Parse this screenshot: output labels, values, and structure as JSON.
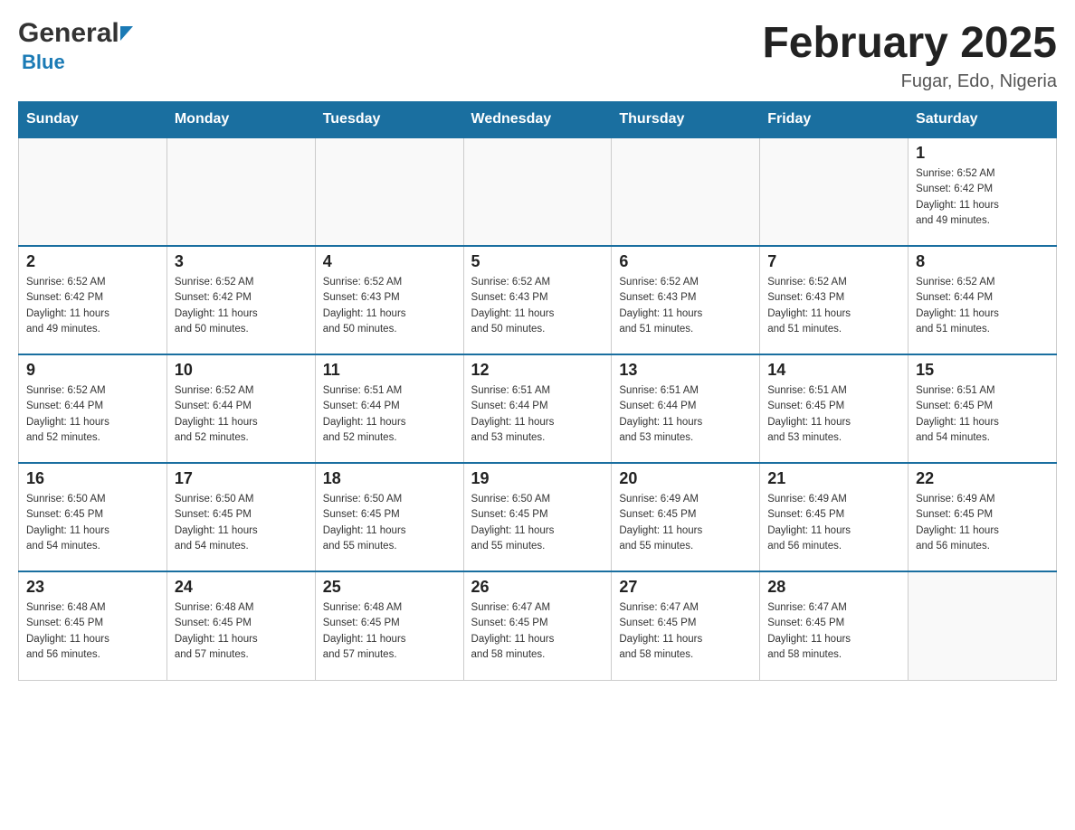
{
  "header": {
    "logo_general": "General",
    "logo_blue": "Blue",
    "month_title": "February 2025",
    "location": "Fugar, Edo, Nigeria"
  },
  "days_of_week": [
    "Sunday",
    "Monday",
    "Tuesday",
    "Wednesday",
    "Thursday",
    "Friday",
    "Saturday"
  ],
  "weeks": [
    [
      {
        "day": "",
        "info": ""
      },
      {
        "day": "",
        "info": ""
      },
      {
        "day": "",
        "info": ""
      },
      {
        "day": "",
        "info": ""
      },
      {
        "day": "",
        "info": ""
      },
      {
        "day": "",
        "info": ""
      },
      {
        "day": "1",
        "info": "Sunrise: 6:52 AM\nSunset: 6:42 PM\nDaylight: 11 hours\nand 49 minutes."
      }
    ],
    [
      {
        "day": "2",
        "info": "Sunrise: 6:52 AM\nSunset: 6:42 PM\nDaylight: 11 hours\nand 49 minutes."
      },
      {
        "day": "3",
        "info": "Sunrise: 6:52 AM\nSunset: 6:42 PM\nDaylight: 11 hours\nand 50 minutes."
      },
      {
        "day": "4",
        "info": "Sunrise: 6:52 AM\nSunset: 6:43 PM\nDaylight: 11 hours\nand 50 minutes."
      },
      {
        "day": "5",
        "info": "Sunrise: 6:52 AM\nSunset: 6:43 PM\nDaylight: 11 hours\nand 50 minutes."
      },
      {
        "day": "6",
        "info": "Sunrise: 6:52 AM\nSunset: 6:43 PM\nDaylight: 11 hours\nand 51 minutes."
      },
      {
        "day": "7",
        "info": "Sunrise: 6:52 AM\nSunset: 6:43 PM\nDaylight: 11 hours\nand 51 minutes."
      },
      {
        "day": "8",
        "info": "Sunrise: 6:52 AM\nSunset: 6:44 PM\nDaylight: 11 hours\nand 51 minutes."
      }
    ],
    [
      {
        "day": "9",
        "info": "Sunrise: 6:52 AM\nSunset: 6:44 PM\nDaylight: 11 hours\nand 52 minutes."
      },
      {
        "day": "10",
        "info": "Sunrise: 6:52 AM\nSunset: 6:44 PM\nDaylight: 11 hours\nand 52 minutes."
      },
      {
        "day": "11",
        "info": "Sunrise: 6:51 AM\nSunset: 6:44 PM\nDaylight: 11 hours\nand 52 minutes."
      },
      {
        "day": "12",
        "info": "Sunrise: 6:51 AM\nSunset: 6:44 PM\nDaylight: 11 hours\nand 53 minutes."
      },
      {
        "day": "13",
        "info": "Sunrise: 6:51 AM\nSunset: 6:44 PM\nDaylight: 11 hours\nand 53 minutes."
      },
      {
        "day": "14",
        "info": "Sunrise: 6:51 AM\nSunset: 6:45 PM\nDaylight: 11 hours\nand 53 minutes."
      },
      {
        "day": "15",
        "info": "Sunrise: 6:51 AM\nSunset: 6:45 PM\nDaylight: 11 hours\nand 54 minutes."
      }
    ],
    [
      {
        "day": "16",
        "info": "Sunrise: 6:50 AM\nSunset: 6:45 PM\nDaylight: 11 hours\nand 54 minutes."
      },
      {
        "day": "17",
        "info": "Sunrise: 6:50 AM\nSunset: 6:45 PM\nDaylight: 11 hours\nand 54 minutes."
      },
      {
        "day": "18",
        "info": "Sunrise: 6:50 AM\nSunset: 6:45 PM\nDaylight: 11 hours\nand 55 minutes."
      },
      {
        "day": "19",
        "info": "Sunrise: 6:50 AM\nSunset: 6:45 PM\nDaylight: 11 hours\nand 55 minutes."
      },
      {
        "day": "20",
        "info": "Sunrise: 6:49 AM\nSunset: 6:45 PM\nDaylight: 11 hours\nand 55 minutes."
      },
      {
        "day": "21",
        "info": "Sunrise: 6:49 AM\nSunset: 6:45 PM\nDaylight: 11 hours\nand 56 minutes."
      },
      {
        "day": "22",
        "info": "Sunrise: 6:49 AM\nSunset: 6:45 PM\nDaylight: 11 hours\nand 56 minutes."
      }
    ],
    [
      {
        "day": "23",
        "info": "Sunrise: 6:48 AM\nSunset: 6:45 PM\nDaylight: 11 hours\nand 56 minutes."
      },
      {
        "day": "24",
        "info": "Sunrise: 6:48 AM\nSunset: 6:45 PM\nDaylight: 11 hours\nand 57 minutes."
      },
      {
        "day": "25",
        "info": "Sunrise: 6:48 AM\nSunset: 6:45 PM\nDaylight: 11 hours\nand 57 minutes."
      },
      {
        "day": "26",
        "info": "Sunrise: 6:47 AM\nSunset: 6:45 PM\nDaylight: 11 hours\nand 58 minutes."
      },
      {
        "day": "27",
        "info": "Sunrise: 6:47 AM\nSunset: 6:45 PM\nDaylight: 11 hours\nand 58 minutes."
      },
      {
        "day": "28",
        "info": "Sunrise: 6:47 AM\nSunset: 6:45 PM\nDaylight: 11 hours\nand 58 minutes."
      },
      {
        "day": "",
        "info": ""
      }
    ]
  ]
}
